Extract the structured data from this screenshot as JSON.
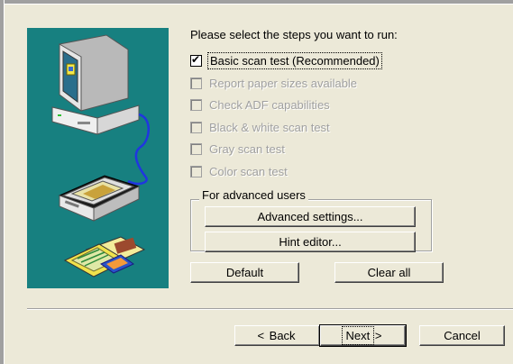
{
  "dialog": {
    "prompt": "Please select the steps you want to run:",
    "options": [
      {
        "label": "Basic scan test (Recommended)",
        "checked": true,
        "enabled": true
      },
      {
        "label": "Report paper sizes available",
        "checked": false,
        "enabled": false
      },
      {
        "label": "Check ADF capabilities",
        "checked": false,
        "enabled": false
      },
      {
        "label": "Black & white scan test",
        "checked": false,
        "enabled": false
      },
      {
        "label": "Gray scan test",
        "checked": false,
        "enabled": false
      },
      {
        "label": "Color scan test",
        "checked": false,
        "enabled": false
      }
    ],
    "advanced_group": {
      "legend": "For advanced users",
      "advanced_settings_label": "Advanced settings...",
      "hint_editor_label": "Hint editor..."
    },
    "default_label": "Default",
    "clear_all_label": "Clear all"
  },
  "footer": {
    "back_label": "Back",
    "next_label": "Next",
    "cancel_label": "Cancel"
  },
  "illustration": {
    "icons": [
      "computer-icon",
      "scanner-icon",
      "documents-icon"
    ],
    "background_color": "#178080"
  },
  "colors": {
    "dialog_bg": "#ece9d8",
    "disabled_text": "#a0a0a0"
  }
}
